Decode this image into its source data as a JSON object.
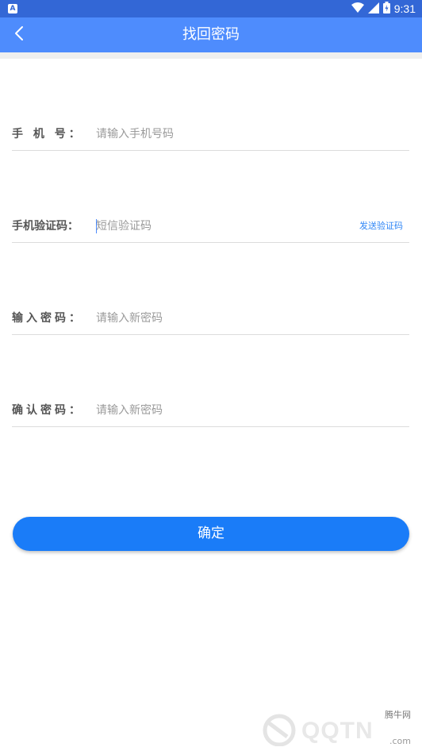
{
  "status_bar": {
    "time": "9:31",
    "left_icon": "A"
  },
  "app_bar": {
    "title": "找回密码"
  },
  "form": {
    "phone": {
      "label": "手 机 号：",
      "placeholder": "请输入手机号码"
    },
    "code": {
      "label": "手机验证码：",
      "placeholder": "短信验证码",
      "send_label": "发送验证码"
    },
    "new_password": {
      "label": "输入密码：",
      "placeholder": "请输入新密码"
    },
    "confirm_password": {
      "label": "确认密码：",
      "placeholder": "请输入新密码"
    }
  },
  "confirm_button": {
    "label": "确定"
  },
  "watermark": {
    "top": "腾牛网",
    "main": "QQTN",
    "suffix": ".com"
  },
  "colors": {
    "status_bar": "#3367d6",
    "app_bar": "#4e8cfd",
    "primary_button": "#1a7cf8",
    "link": "#2f86f6"
  },
  "icons": {
    "back": "chevron-left-icon",
    "wifi": "wifi-icon",
    "signal": "signal-icon",
    "battery": "battery-icon"
  }
}
